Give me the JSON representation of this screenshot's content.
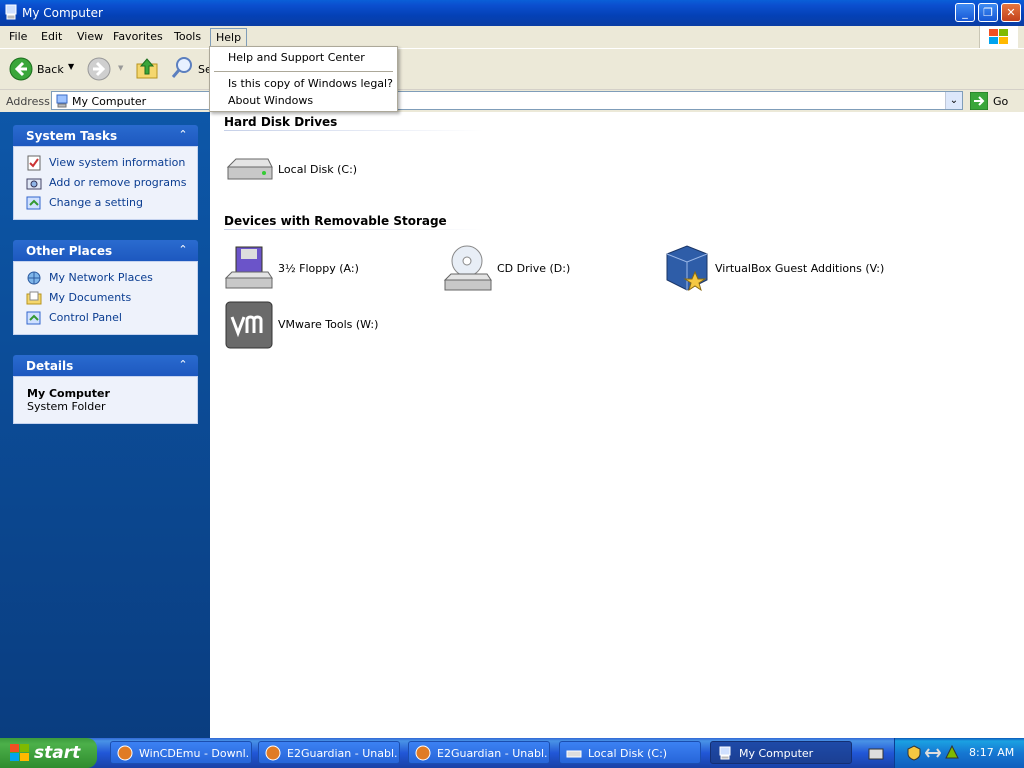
{
  "window": {
    "title": "My Computer"
  },
  "menubar": {
    "items": [
      "File",
      "Edit",
      "View",
      "Favorites",
      "Tools",
      "Help"
    ]
  },
  "toolbar": {
    "back_label": "Back",
    "search_label_partial": "Se"
  },
  "address": {
    "label": "Address",
    "value": "My Computer",
    "go_label": "Go"
  },
  "help_menu": {
    "items": [
      "Help and Support Center",
      "Is this copy of Windows legal?",
      "About Windows"
    ]
  },
  "left_pane": {
    "system_tasks": {
      "title": "System Tasks",
      "items": [
        "View system information",
        "Add or remove programs",
        "Change a setting"
      ]
    },
    "other_places": {
      "title": "Other Places",
      "items": [
        "My Network Places",
        "My Documents",
        "Control Panel"
      ]
    },
    "details": {
      "title": "Details",
      "name": "My Computer",
      "subtitle": "System Folder"
    }
  },
  "content": {
    "groups": [
      {
        "title": "Hard Disk Drives",
        "items": [
          "Local Disk (C:)"
        ]
      },
      {
        "title": "Devices with Removable Storage",
        "items": [
          "3½ Floppy (A:)",
          "CD Drive (D:)",
          "VirtualBox Guest Additions (V:)",
          "VMware Tools (W:)"
        ]
      }
    ]
  },
  "taskbar": {
    "start_label": "start",
    "buttons": [
      "WinCDEmu - Downl...",
      "E2Guardian - Unabl...",
      "E2Guardian - Unabl...",
      "Local Disk (C:)",
      "My Computer"
    ],
    "clock": "8:17 AM"
  }
}
